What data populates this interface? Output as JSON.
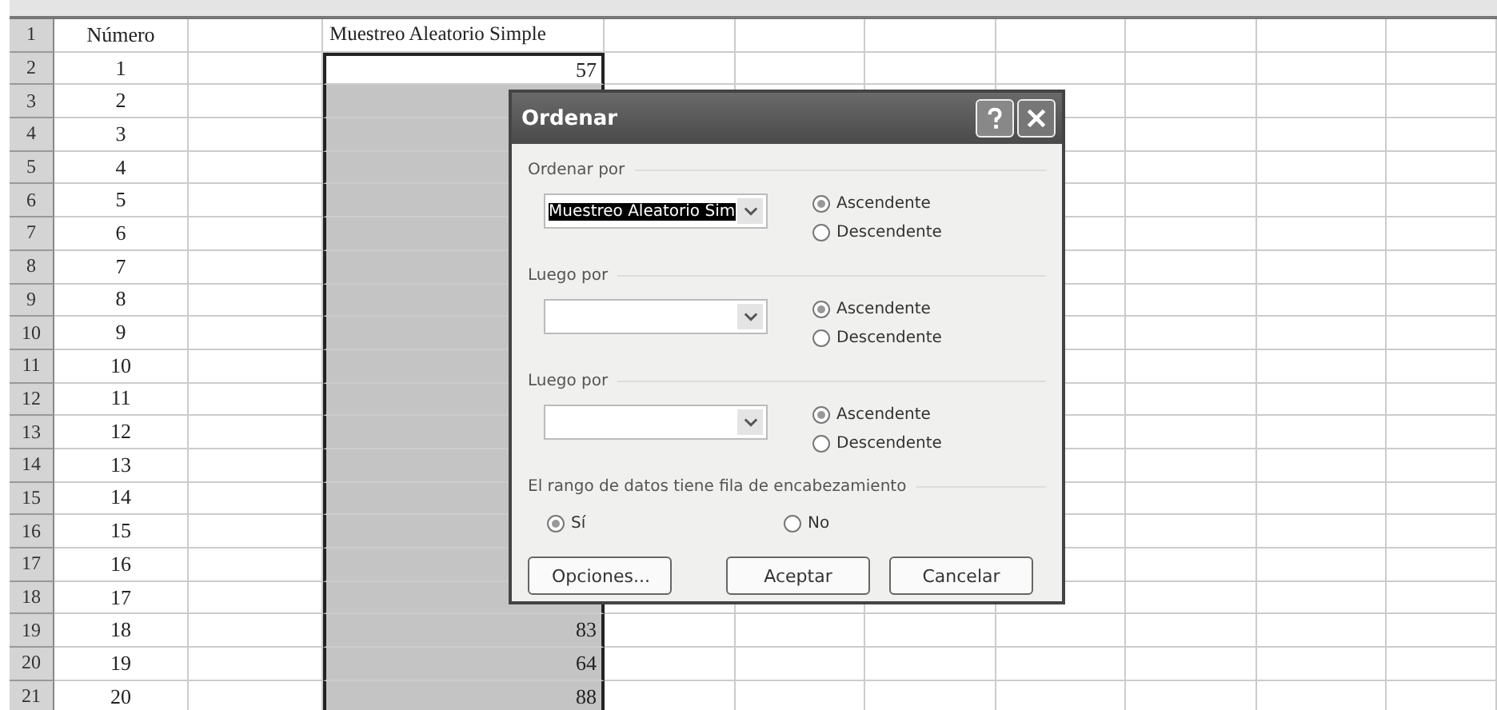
{
  "sheet": {
    "rows": [
      {
        "number": "1",
        "cells": [
          "Número",
          "",
          "Muestreo Aleatorio Simple"
        ]
      },
      {
        "number": "2",
        "cells": [
          "1",
          "",
          "57"
        ]
      },
      {
        "number": "3",
        "cells": [
          "2",
          "",
          ""
        ]
      },
      {
        "number": "4",
        "cells": [
          "3",
          "",
          ""
        ]
      },
      {
        "number": "5",
        "cells": [
          "4",
          "",
          ""
        ]
      },
      {
        "number": "6",
        "cells": [
          "5",
          "",
          ""
        ]
      },
      {
        "number": "7",
        "cells": [
          "6",
          "",
          ""
        ]
      },
      {
        "number": "8",
        "cells": [
          "7",
          "",
          ""
        ]
      },
      {
        "number": "9",
        "cells": [
          "8",
          "",
          ""
        ]
      },
      {
        "number": "10",
        "cells": [
          "9",
          "",
          ""
        ]
      },
      {
        "number": "11",
        "cells": [
          "10",
          "",
          ""
        ]
      },
      {
        "number": "12",
        "cells": [
          "11",
          "",
          ""
        ]
      },
      {
        "number": "13",
        "cells": [
          "12",
          "",
          ""
        ]
      },
      {
        "number": "14",
        "cells": [
          "13",
          "",
          ""
        ]
      },
      {
        "number": "15",
        "cells": [
          "14",
          "",
          ""
        ]
      },
      {
        "number": "16",
        "cells": [
          "15",
          "",
          ""
        ]
      },
      {
        "number": "17",
        "cells": [
          "16",
          "",
          ""
        ]
      },
      {
        "number": "18",
        "cells": [
          "17",
          "",
          ""
        ]
      },
      {
        "number": "19",
        "cells": [
          "18",
          "",
          "83"
        ]
      },
      {
        "number": "20",
        "cells": [
          "19",
          "",
          "64"
        ]
      },
      {
        "number": "21",
        "cells": [
          "20",
          "",
          "88"
        ]
      }
    ]
  },
  "dialog": {
    "title": "Ordenar",
    "sections": [
      {
        "label": "Ordenar por",
        "value": "Muestreo Aleatorio Sim",
        "options": [
          {
            "label": "Ascendente",
            "selected": true
          },
          {
            "label": "Descendente",
            "selected": false
          }
        ]
      },
      {
        "label": "Luego por",
        "options": [
          {
            "label": "Ascendente",
            "selected": true
          },
          {
            "label": "Descendente",
            "selected": false
          }
        ]
      },
      {
        "label": "Luego por",
        "options": [
          {
            "label": "Ascendente",
            "selected": true
          },
          {
            "label": "Descendente",
            "selected": false
          }
        ]
      }
    ],
    "header_question": "El rango de datos tiene fila de encabezamiento",
    "header_options": [
      {
        "label": "Sí",
        "selected": true
      },
      {
        "label": "No",
        "selected": false
      }
    ],
    "buttons": [
      "Opciones...",
      "Aceptar",
      "Cancelar"
    ]
  }
}
